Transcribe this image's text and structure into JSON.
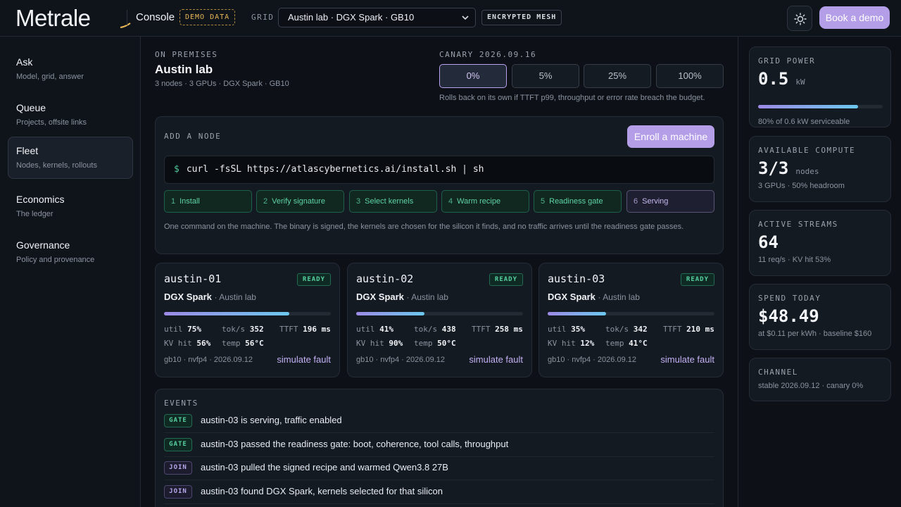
{
  "header": {
    "logo": "Metrale",
    "console_label": "Console",
    "demo_badge": "DEMO DATA",
    "grid_label": "GRID",
    "grid_value": "Austin lab · DGX Spark · GB10",
    "encrypted_badge": "ENCRYPTED MESH",
    "theme_icon": "sun-icon",
    "book_demo": "Book a demo",
    "accent_color": "#b49ee8"
  },
  "sidebar": {
    "items": [
      {
        "title": "Ask",
        "sub": "Model, grid, answer",
        "active": false
      },
      {
        "title": "Queue",
        "sub": "Projects, offsite links",
        "active": false
      },
      {
        "title": "Fleet",
        "sub": "Nodes, kernels, rollouts",
        "active": true
      },
      {
        "title": "Economics",
        "sub": "The ledger",
        "active": false
      },
      {
        "title": "Governance",
        "sub": "Policy and provenance",
        "active": false
      }
    ]
  },
  "site": {
    "eyebrow": "ON PREMISES",
    "title": "Austin lab",
    "sub": "3 nodes · 3 GPUs · DGX Spark · GB10"
  },
  "canary": {
    "eyebrow": "CANARY 2026.09.16",
    "options": [
      "0%",
      "5%",
      "25%",
      "100%"
    ],
    "selected": "0%",
    "note": "Rolls back on its own if TTFT p99, throughput or error rate breach the budget."
  },
  "add_node": {
    "eyebrow": "ADD A NODE",
    "enroll_button": "Enroll a machine",
    "prompt": "$",
    "command": "curl -fsSL https://atlascybernetics.ai/install.sh | sh",
    "steps": [
      {
        "num": "1",
        "label": "Install"
      },
      {
        "num": "2",
        "label": "Verify signature"
      },
      {
        "num": "3",
        "label": "Select kernels"
      },
      {
        "num": "4",
        "label": "Warm recipe"
      },
      {
        "num": "5",
        "label": "Readiness gate"
      },
      {
        "num": "6",
        "label": "Serving"
      }
    ],
    "note": "One command on the machine. The binary is signed, the kernels are chosen for the silicon it finds, and no traffic arrives until the readiness gate passes."
  },
  "nodes": [
    {
      "name": "austin-01",
      "status": "READY",
      "model": "DGX Spark",
      "site": "· Austin lab",
      "util_fraction": 0.75,
      "util_label": "util",
      "util": "75%",
      "toks_label": "tok/s",
      "toks": "352",
      "ttft_label": "TTFT",
      "ttft": "196 ms",
      "kv_label": "KV hit",
      "kv": "56%",
      "temp_label": "temp",
      "temp": "56°C",
      "footer": "gb10 · nvfp4 · 2026.09.12",
      "fault_link": "simulate fault"
    },
    {
      "name": "austin-02",
      "status": "READY",
      "model": "DGX Spark",
      "site": "· Austin lab",
      "util_fraction": 0.41,
      "util_label": "util",
      "util": "41%",
      "toks_label": "tok/s",
      "toks": "438",
      "ttft_label": "TTFT",
      "ttft": "258 ms",
      "kv_label": "KV hit",
      "kv": "90%",
      "temp_label": "temp",
      "temp": "50°C",
      "footer": "gb10 · nvfp4 · 2026.09.12",
      "fault_link": "simulate fault"
    },
    {
      "name": "austin-03",
      "status": "READY",
      "model": "DGX Spark",
      "site": "· Austin lab",
      "util_fraction": 0.35,
      "util_label": "util",
      "util": "35%",
      "toks_label": "tok/s",
      "toks": "342",
      "ttft_label": "TTFT",
      "ttft": "210 ms",
      "kv_label": "KV hit",
      "kv": "12%",
      "temp_label": "temp",
      "temp": "41°C",
      "footer": "gb10 · nvfp4 · 2026.09.12",
      "fault_link": "simulate fault"
    }
  ],
  "events": {
    "eyebrow": "EVENTS",
    "items": [
      {
        "tag": "GATE",
        "kind": "gate",
        "text": "austin-03 is serving, traffic enabled"
      },
      {
        "tag": "GATE",
        "kind": "gate",
        "text": "austin-03 passed the readiness gate: boot, coherence, tool calls, throughput"
      },
      {
        "tag": "JOIN",
        "kind": "join",
        "text": "austin-03 pulled the signed recipe and warmed Qwen3.8 27B"
      },
      {
        "tag": "JOIN",
        "kind": "join",
        "text": "austin-03 found DGX Spark, kernels selected for that silicon"
      }
    ]
  },
  "stats": {
    "power": {
      "eyebrow": "GRID POWER",
      "value": "0.5",
      "unit": "kW",
      "fraction": 0.8,
      "sub": "80% of 0.6 kW serviceable"
    },
    "compute": {
      "eyebrow": "AVAILABLE COMPUTE",
      "value": "3/3",
      "unit": "nodes",
      "sub": "3 GPUs · 50% headroom"
    },
    "streams": {
      "eyebrow": "ACTIVE STREAMS",
      "value": "64",
      "sub": "11 req/s · KV hit 53%"
    },
    "spend": {
      "eyebrow": "SPEND TODAY",
      "value": "$48.49",
      "sub": "at $0.11 per kWh · baseline $160"
    },
    "channel": {
      "eyebrow": "CHANNEL",
      "sub": "stable 2026.09.12 · canary 0%"
    }
  }
}
